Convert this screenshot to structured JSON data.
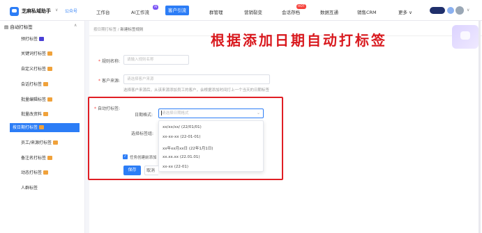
{
  "header": {
    "app_name": "芝麻私域助手",
    "app_tag": "公众号",
    "nav": [
      {
        "label": "工作台"
      },
      {
        "label": "AI工作流",
        "badge": "AI"
      },
      {
        "label": "客户引流"
      },
      {
        "label": "群管理"
      },
      {
        "label": "营销裂变"
      },
      {
        "label": "会话存档",
        "badge": "HOT"
      },
      {
        "label": "数据互通"
      },
      {
        "label": "销售CRM"
      },
      {
        "label": "更多"
      }
    ],
    "active_nav": "客户引流"
  },
  "sidebar": {
    "group_label": "自动打标签",
    "items": [
      {
        "label": "预打标签",
        "gem_color": "#4a3fd6"
      },
      {
        "label": "关键词打标签",
        "gem_color": "#f0a23b"
      },
      {
        "label": "自定义打标签",
        "gem_color": "#f0a23b"
      },
      {
        "label": "会话打标签",
        "gem_color": "#f0a23b"
      },
      {
        "label": "批量编辑标签",
        "gem_color": "#f0a23b"
      },
      {
        "label": "批量改资料",
        "gem_color": "#f0a23b"
      },
      {
        "label": "按日期打标签",
        "gem_color": "#f0a23b",
        "active": true
      },
      {
        "label": "员工/来源打标签",
        "gem_color": "#f0a23b"
      },
      {
        "label": "备注名打标签",
        "gem_color": "#f0a23b"
      },
      {
        "label": "动态打标签",
        "gem_color": "#f0a23b"
      },
      {
        "label": "人群标签"
      }
    ]
  },
  "breadcrumb": {
    "parent": "按日期打标签",
    "separator": "/",
    "current": "新建标签规则"
  },
  "overlay_title": "根据添加日期自动打标签",
  "form": {
    "rule_name_label": "规则名称:",
    "rule_name_placeholder": "请输入规则名称",
    "source_label": "客户来源:",
    "source_placeholder": "请选择客户来源",
    "source_hint": "选择客户来源后，从该来源添加员工的客户，会根据添加时间打上一个当天的日期标签",
    "auto_tag_label": "自动打标签:",
    "date_format_label": "日期格式:",
    "date_format_placeholder": "请选择日期格式",
    "tag_group_label": "选择标签组:",
    "date_format_options": [
      "xx/xx/xx/ (22/01/01)",
      "xx-xx-xx (22-01-01)",
      "xx年xx月xx日 (22年1月1日)",
      "xx.xx.xx (22.01.01)",
      "xx-xx (22-01)"
    ],
    "checkbox_label": "任务创建前添加",
    "save_label": "保存",
    "cancel_label": "取消"
  },
  "colors": {
    "accent": "#2c7df6",
    "highlight": "#e01e24"
  }
}
